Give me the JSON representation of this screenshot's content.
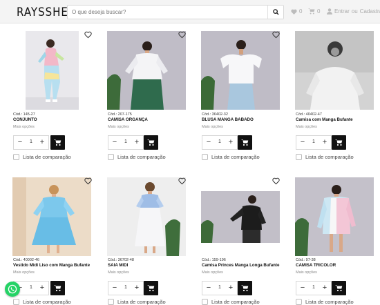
{
  "header": {
    "logo": "RAYSSHEL",
    "search_placeholder": "O que deseja buscar?",
    "wishlist_count": "0",
    "cart_count": "0",
    "login_text": "Entrar",
    "or_text": "ou",
    "register_text": "Cadastrar"
  },
  "products": [
    {
      "code": "Cód.: 145-27",
      "name": "CONJUNTO",
      "options": "Mais opções",
      "qty": "1",
      "compare": "Lista de comparação"
    },
    {
      "code": "Cód.: 207-175",
      "name": "CAMISA ORGANÇA",
      "options": "Mais opções",
      "qty": "1",
      "compare": "Lista de comparação"
    },
    {
      "code": "Cód.: 36402-32",
      "name": "BLUSA MANGA BABADO",
      "options": "Mais opções",
      "qty": "1",
      "compare": "Lista de comparação"
    },
    {
      "code": "Cód.: 40402-47",
      "name": "Camisa com Manga Bufante",
      "options": "Mais opções",
      "qty": "1",
      "compare": "Lista de comparação"
    },
    {
      "code": "Cód.: 40002-46",
      "name": "Vestido Midi Liso com Manga Bufante",
      "options": "Mais opções",
      "qty": "1",
      "compare": "Lista de comparação"
    },
    {
      "code": "Cód.: 36702-48",
      "name": "SAIA MIDI",
      "options": "Mais opções",
      "qty": "1",
      "compare": "Lista de comparação"
    },
    {
      "code": "Cód.: 159-196",
      "name": "Camisa Princes Manga Longa Bufante",
      "options": "Mais opções",
      "qty": "1",
      "compare": "Lista de comparação"
    },
    {
      "code": "Cód.: 97-38",
      "name": "CAMISA TRICOLOR",
      "options": "Mais opções",
      "qty": "1",
      "compare": "Lista de comparação"
    }
  ],
  "symbols": {
    "minus": "−",
    "plus": "+"
  },
  "colors": {
    "cart_button": "#111111",
    "whatsapp": "#25d366",
    "header_bg": "#f4f4f4"
  }
}
